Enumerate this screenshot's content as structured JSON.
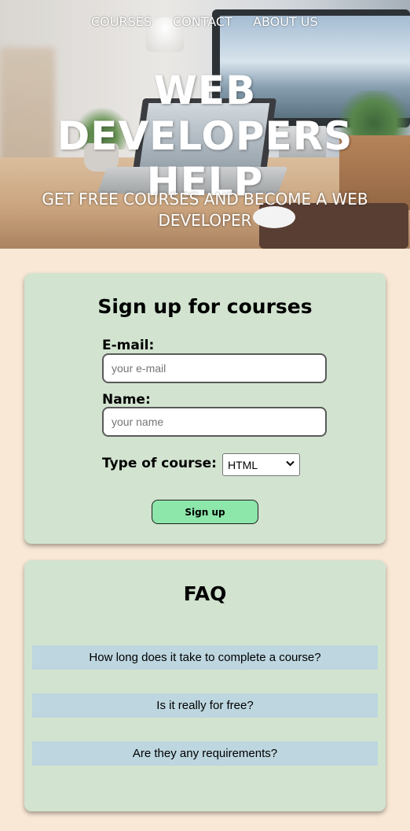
{
  "nav": {
    "items": [
      {
        "label": "COURSES"
      },
      {
        "label": "CONTACT"
      },
      {
        "label": "ABOUT US"
      }
    ]
  },
  "hero": {
    "title_line1": "WEB DEVELOPERS",
    "title_line2": "HELP",
    "subtitle_line1": "GET FREE COURSES AND BECOME A WEB",
    "subtitle_line2": "DEVELOPER",
    "image_icon": "desk-workspace-photo"
  },
  "signup": {
    "title": "Sign up for courses",
    "email_label": "E-mail:",
    "email_placeholder": "your e-mail",
    "email_value": "",
    "name_label": "Name:",
    "name_placeholder": "your name",
    "name_value": "",
    "course_label": "Type of course:",
    "course_selected": "HTML",
    "button_label": "Sign up"
  },
  "faq": {
    "title": "FAQ",
    "questions": [
      "How long does it take to complete a course?",
      "Is it really for free?",
      "Are they any requirements?"
    ]
  },
  "colors": {
    "page_bg": "#f9e8d6",
    "card_bg": "#d2e4d0",
    "button_bg": "#8de6aa",
    "faq_item_bg": "#bdd6df"
  }
}
